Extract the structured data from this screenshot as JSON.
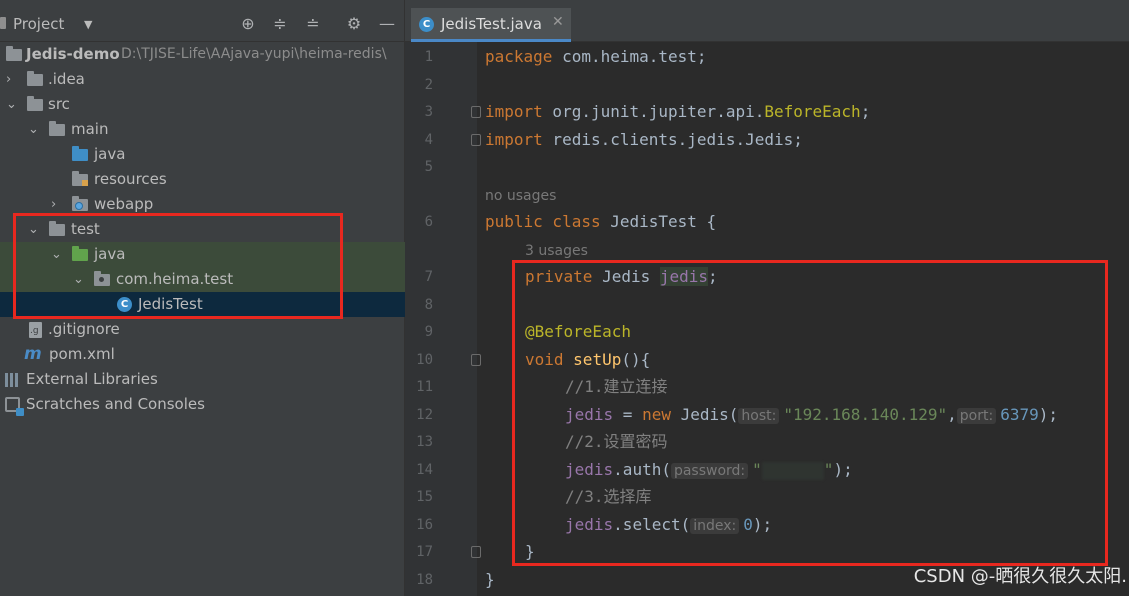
{
  "project_panel": {
    "title": "Project",
    "tree": [
      {
        "label": "Jedis-demo",
        "hint": "D:\\TJISE-Life\\AAjava-yupi\\heima-redis\\"
      },
      {
        "label": ".idea"
      },
      {
        "label": "src"
      },
      {
        "label": "main"
      },
      {
        "label": "java"
      },
      {
        "label": "resources"
      },
      {
        "label": "webapp"
      },
      {
        "label": "test"
      },
      {
        "label": "java"
      },
      {
        "label": "com.heima.test"
      },
      {
        "label": "JedisTest"
      },
      {
        "label": ".gitignore"
      },
      {
        "label": "pom.xml"
      },
      {
        "label": "External Libraries"
      },
      {
        "label": "Scratches and Consoles"
      }
    ]
  },
  "editor": {
    "tab_title": "JedisTest.java",
    "line_numbers": [
      "1",
      "2",
      "3",
      "4",
      "5",
      "6",
      "7",
      "8",
      "9",
      "10",
      "11",
      "12",
      "13",
      "14",
      "15",
      "16",
      "17",
      "18"
    ],
    "usage_hints": {
      "class": "no usages",
      "field": "3 usages"
    },
    "code": {
      "l1": {
        "kw": "package",
        "rest": " com.heima.test;"
      },
      "l3": {
        "kw": "import",
        "a": " org.junit.jupiter.api.",
        "b": "BeforeEach",
        "c": ";"
      },
      "l4": {
        "kw": "import",
        "rest": " redis.clients.jedis.Jedis;"
      },
      "l6": {
        "kw": "public class",
        "rest": " JedisTest {"
      },
      "l7": {
        "kw": "private",
        "type": " Jedis ",
        "field": "jedis",
        "end": ";"
      },
      "l9": {
        "ann": "@BeforeEach"
      },
      "l10": {
        "kw": "void",
        "fn": "setUp",
        "rest": "(){"
      },
      "l11": {
        "comment": "//1.建立连接"
      },
      "l12": {
        "field": "jedis",
        "eq": " = ",
        "kw": "new",
        "call": " Jedis(",
        "p1": "host:",
        "s1": "\"192.168.140.129\"",
        "comma": ",",
        "p2": "port:",
        "n2": "6379",
        "end": ");"
      },
      "l13": {
        "comment": "//2.设置密码"
      },
      "l14": {
        "field": "jedis",
        "call": ".auth(",
        "p1": "password:",
        "q1": "\"",
        "q2": "\"",
        "end": ");"
      },
      "l15": {
        "comment": "//3.选择库"
      },
      "l16": {
        "field": "jedis",
        "call": ".select(",
        "p1": "index:",
        "n1": "0",
        "end": ");"
      },
      "l17": {
        "rest": "}"
      },
      "l18": {
        "rest": "}"
      }
    }
  },
  "watermark": "CSDN @-晒很久很久太阳.",
  "colors": {
    "highlight_box": "#e8281f",
    "selection": "#0d293e",
    "test_bg": "#3c4b3a"
  }
}
